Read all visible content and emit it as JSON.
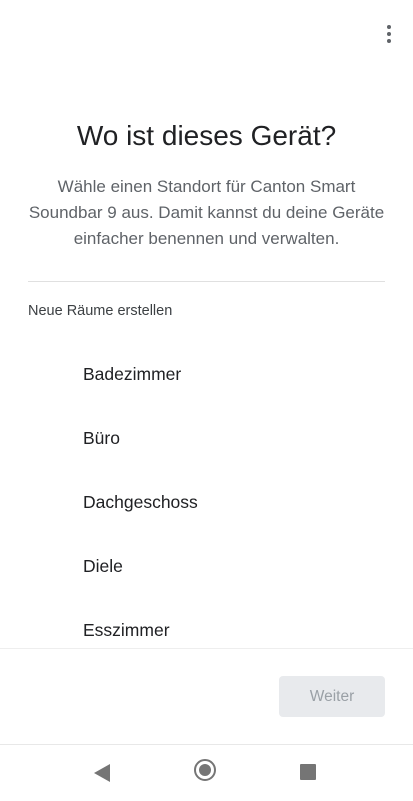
{
  "header": {
    "menu_icon": "more-vert-icon"
  },
  "page": {
    "title": "Wo ist dieses Gerät?",
    "subtitle": "Wähle einen Standort für Canton Smart Soundbar 9 aus. Damit kannst du deine Geräte einfacher benennen und verwalten."
  },
  "rooms": {
    "section_label": "Neue Räume erstellen",
    "items": [
      "Badezimmer",
      "Büro",
      "Dachgeschoss",
      "Diele",
      "Esszimmer"
    ]
  },
  "footer": {
    "next_label": "Weiter"
  },
  "navbar": {
    "back_icon": "back-triangle-icon",
    "home_icon": "home-circle-icon",
    "recent_icon": "recent-square-icon"
  },
  "colors": {
    "text_primary": "#202124",
    "text_secondary": "#5f6368",
    "button_disabled_bg": "#e8eaed",
    "button_disabled_text": "#9aa0a6"
  }
}
